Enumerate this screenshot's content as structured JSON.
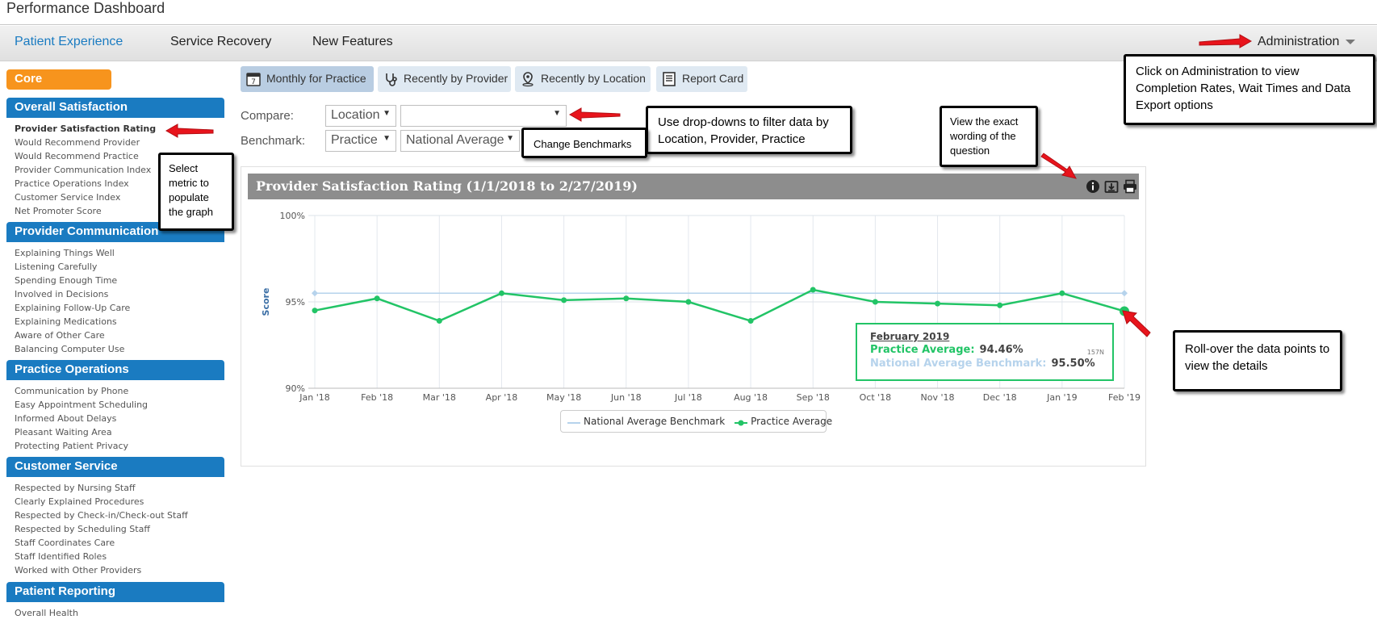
{
  "app": {
    "title": "Performance Dashboard"
  },
  "nav": {
    "tabs": [
      {
        "label": "Patient Experience"
      },
      {
        "label": "Service Recovery"
      },
      {
        "label": "New Features"
      }
    ],
    "admin_label": "Administration"
  },
  "sidebar": {
    "core_label": "Core",
    "sections": [
      {
        "title": "Overall Satisfaction",
        "items": [
          "Provider Satisfaction Rating",
          "Would Recommend Provider",
          "Would Recommend Practice",
          "Provider Communication Index",
          "Practice Operations Index",
          "Customer Service Index",
          "Net Promoter Score"
        ]
      },
      {
        "title": "Provider Communication",
        "items": [
          "Explaining Things Well",
          "Listening Carefully",
          "Spending Enough Time",
          "Involved in Decisions",
          "Explaining Follow-Up Care",
          "Explaining Medications",
          "Aware of Other Care",
          "Balancing Computer Use"
        ]
      },
      {
        "title": "Practice Operations",
        "items": [
          "Communication by Phone",
          "Easy Appointment Scheduling",
          "Informed About Delays",
          "Pleasant Waiting Area",
          "Protecting Patient Privacy"
        ]
      },
      {
        "title": "Customer Service",
        "items": [
          "Respected by Nursing Staff",
          "Clearly Explained Procedures",
          "Respected by Check-in/Check-out Staff",
          "Respected by Scheduling Staff",
          "Staff Coordinates Care",
          "Staff Identified Roles",
          "Worked with Other Providers"
        ]
      },
      {
        "title": "Patient Reporting",
        "items": [
          "Overall Health"
        ]
      }
    ]
  },
  "views": {
    "buttons": [
      {
        "label": "Monthly for Practice",
        "icon": "calendar-icon"
      },
      {
        "label": "Recently by Provider",
        "icon": "stethoscope-icon"
      },
      {
        "label": "Recently by Location",
        "icon": "map-pin-icon"
      },
      {
        "label": "Report Card",
        "icon": "report-card-icon"
      }
    ]
  },
  "filters": {
    "compare_label": "Compare:",
    "benchmark_label": "Benchmark:",
    "compare_select": "Location",
    "compare_value": "",
    "benchmark_select": "Practice",
    "benchmark_value": "National Average"
  },
  "chart": {
    "header_title": "Provider Satisfaction Rating (1/1/2018 to 2/27/2019)",
    "tooltip": {
      "date": "February 2019",
      "practice_label": "Practice Average:",
      "practice_value": "94.46%",
      "n_label": "157N",
      "benchmark_label": "National Average Benchmark:",
      "benchmark_value": "95.50%"
    },
    "colors": {
      "practice": "#22c466",
      "benchmark": "#b6d3ec",
      "header_bg": "#8d8d8d"
    }
  },
  "chart_data": {
    "type": "line",
    "title": "Provider Satisfaction Rating (1/1/2018 to 2/27/2019)",
    "ylabel": "Score",
    "ylim": [
      90,
      100
    ],
    "yticks": [
      "100%",
      "95%",
      "90%"
    ],
    "categories": [
      "Jan '18",
      "Feb '18",
      "Mar '18",
      "Apr '18",
      "May '18",
      "Jun '18",
      "Jul '18",
      "Aug '18",
      "Sep '18",
      "Oct '18",
      "Nov '18",
      "Dec '18",
      "Jan '19",
      "Feb '19"
    ],
    "series": [
      {
        "name": "National Average Benchmark",
        "color": "#b6d3ec",
        "values": [
          95.5,
          95.5,
          95.5,
          95.5,
          95.5,
          95.5,
          95.5,
          95.5,
          95.5,
          95.5,
          95.5,
          95.5,
          95.5,
          95.5
        ]
      },
      {
        "name": "Practice Average",
        "color": "#22c466",
        "values": [
          94.5,
          95.2,
          93.9,
          95.5,
          95.1,
          95.2,
          95.0,
          93.9,
          95.7,
          95.0,
          94.9,
          94.8,
          95.5,
          94.46
        ]
      }
    ],
    "legend": "bottom-center",
    "grid": true
  },
  "callouts": {
    "admin": "Click on Administration to view Completion Rates, Wait Times and Data Export options",
    "dropdowns": "Use drop-downs to filter data by Location, Provider, Practice",
    "benchmarks": "Change Benchmarks",
    "wording": "View the exact wording of the question",
    "metric": "Select metric to populate the graph",
    "rollover": "Roll-over the data points to view the details"
  }
}
